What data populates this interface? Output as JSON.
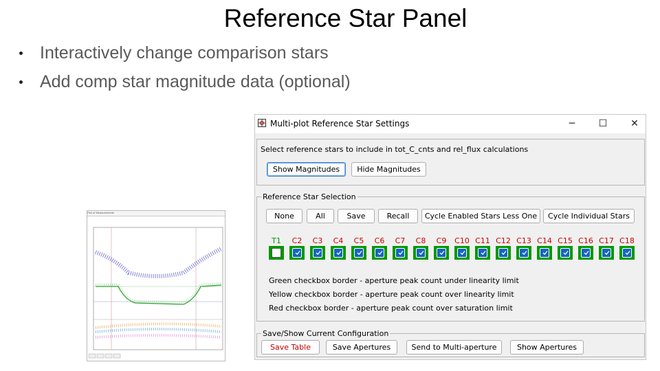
{
  "slide": {
    "title": "Reference Star Panel",
    "bullets": [
      "Interactively change comparison stars",
      "Add comp star magnitude data (optional)"
    ]
  },
  "thumbnail": {
    "window_title": "Plot of Measurements"
  },
  "dialog": {
    "title": "Multi-plot Reference Star Settings",
    "controls": {
      "minimize": "─",
      "maximize": "☐",
      "close": "✕"
    },
    "instruction": "Select reference stars to include in tot_C_cnts and rel_flux calculations",
    "magnitude_buttons": {
      "show": "Show Magnitudes",
      "hide": "Hide Magnitudes"
    },
    "selection": {
      "legend": "Reference Star Selection",
      "buttons": {
        "none": "None",
        "all": "All",
        "save": "Save",
        "recall": "Recall",
        "cycle_less_one": "Cycle Enabled Stars Less One",
        "cycle_individual": "Cycle Individual Stars"
      },
      "stars": [
        {
          "label": "T1",
          "checked": false,
          "color": "#009900"
        },
        {
          "label": "C2",
          "checked": true,
          "color": "#cc0000"
        },
        {
          "label": "C3",
          "checked": true,
          "color": "#cc0000"
        },
        {
          "label": "C4",
          "checked": true,
          "color": "#cc0000"
        },
        {
          "label": "C5",
          "checked": true,
          "color": "#cc0000"
        },
        {
          "label": "C6",
          "checked": true,
          "color": "#cc0000"
        },
        {
          "label": "C7",
          "checked": true,
          "color": "#cc0000"
        },
        {
          "label": "C8",
          "checked": true,
          "color": "#cc0000"
        },
        {
          "label": "C9",
          "checked": true,
          "color": "#cc0000"
        },
        {
          "label": "C10",
          "checked": true,
          "color": "#cc0000"
        },
        {
          "label": "C11",
          "checked": true,
          "color": "#cc0000"
        },
        {
          "label": "C12",
          "checked": true,
          "color": "#cc0000"
        },
        {
          "label": "C13",
          "checked": true,
          "color": "#cc0000"
        },
        {
          "label": "C14",
          "checked": true,
          "color": "#cc0000"
        },
        {
          "label": "C15",
          "checked": true,
          "color": "#cc0000"
        },
        {
          "label": "C16",
          "checked": true,
          "color": "#cc0000"
        },
        {
          "label": "C17",
          "checked": true,
          "color": "#cc0000"
        },
        {
          "label": "C18",
          "checked": true,
          "color": "#cc0000"
        }
      ],
      "notes": [
        "Green checkbox border - aperture peak count under linearity limit",
        "Yellow checkbox border - aperture peak count over linearity limit",
        "Red checkbox border - aperture peak count over saturation limit"
      ]
    },
    "config": {
      "legend": "Save/Show Current Configuration",
      "buttons": {
        "save_table": "Save Table",
        "save_apertures": "Save Apertures",
        "send": "Send to Multi-aperture",
        "show_apertures": "Show Apertures"
      }
    }
  }
}
